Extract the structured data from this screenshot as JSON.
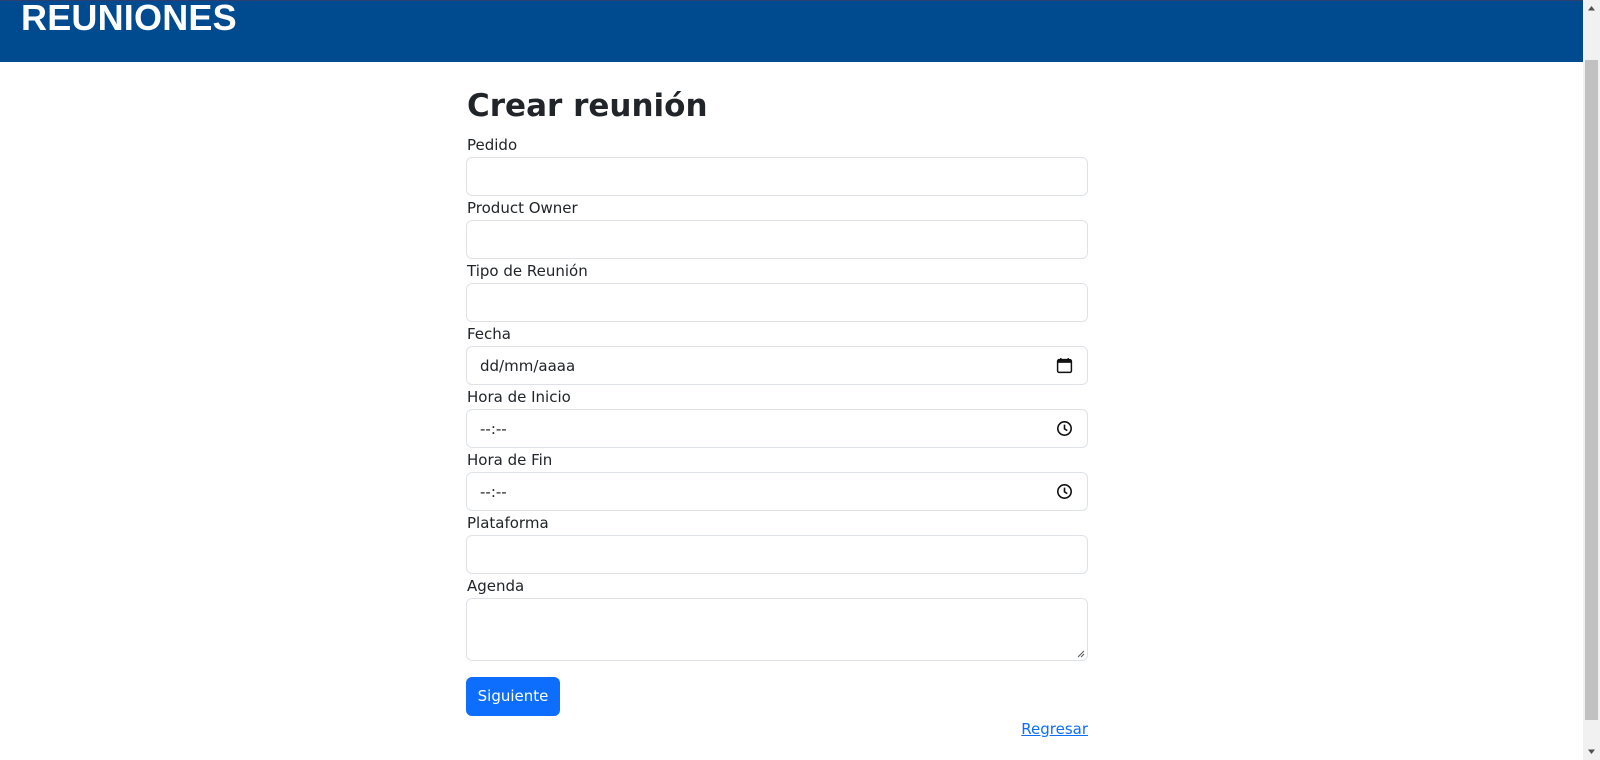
{
  "header": {
    "title": "REUNIONES"
  },
  "form": {
    "title": "Crear reunión",
    "fields": [
      {
        "label": "Pedido",
        "value": ""
      },
      {
        "label": "Product Owner",
        "value": ""
      },
      {
        "label": "Tipo de Reunión",
        "value": ""
      },
      {
        "label": "Fecha",
        "value": "dd/mm/aaaa",
        "icon": "calendar-icon"
      },
      {
        "label": "Hora de Inicio",
        "value": "--:--",
        "icon": "clock-icon"
      },
      {
        "label": "Hora de Fin",
        "value": "--:--",
        "icon": "clock-icon"
      },
      {
        "label": "Plataforma",
        "value": ""
      }
    ],
    "agenda": {
      "label": "Agenda",
      "value": ""
    },
    "submit_label": "Siguiente",
    "back_label": "Regresar"
  },
  "colors": {
    "header_bg": "#004b8f",
    "primary": "#0d6efd",
    "input_border": "#dee2e6"
  }
}
